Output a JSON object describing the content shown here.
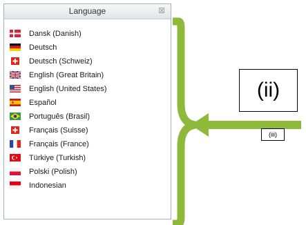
{
  "panel": {
    "title": "Language",
    "close_glyph": "⊠",
    "items": [
      {
        "label": "Dansk (Danish)",
        "flag": "dk"
      },
      {
        "label": "Deutsch",
        "flag": "de"
      },
      {
        "label": "Deutsch (Schweiz)",
        "flag": "ch"
      },
      {
        "label": "English (Great Britain)",
        "flag": "gb"
      },
      {
        "label": "English (United States)",
        "flag": "us"
      },
      {
        "label": "Español",
        "flag": "es"
      },
      {
        "label": "Português (Brasil)",
        "flag": "br"
      },
      {
        "label": "Français (Suisse)",
        "flag": "ch"
      },
      {
        "label": "Français (France)",
        "flag": "fr"
      },
      {
        "label": "Türkiye (Turkish)",
        "flag": "tr"
      },
      {
        "label": "Polski (Polish)",
        "flag": "pl"
      },
      {
        "label": "Indonesian",
        "flag": "id"
      }
    ]
  },
  "annotations": {
    "box_ii": "(ii)",
    "box_iii": "(iii)",
    "accent": "#8fb93a"
  }
}
